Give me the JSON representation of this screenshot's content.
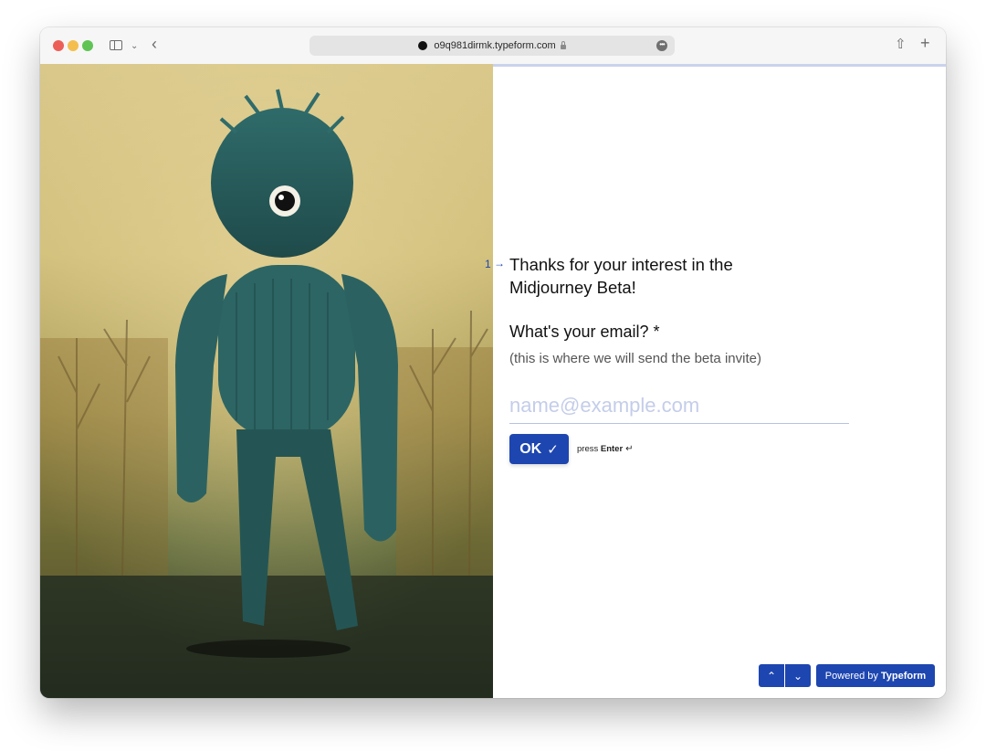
{
  "browser": {
    "url": "o9q981dirmk.typeform.com",
    "more_glyph": "•••"
  },
  "form": {
    "progress": 0.0,
    "question_number": "1",
    "question_arrow": "→",
    "intro_title": "Thanks for your interest in the Midjourney Beta!",
    "email_question": "What's your email? *",
    "email_hint": "(this is where we will send the beta invite)",
    "email_placeholder": "name@example.com",
    "email_value": "",
    "ok_label": "OK",
    "press_label": "press",
    "enter_label": "Enter",
    "enter_glyph": "↵"
  },
  "footer": {
    "powered_by_prefix": "Powered by",
    "brand": "Typeform",
    "up_glyph": "⌃",
    "down_glyph": "⌄"
  },
  "icons": {
    "back": "‹",
    "chevron": "⌄",
    "share": "⇧",
    "new_tab": "+",
    "check": "✓"
  },
  "colors": {
    "accent": "#1e46b0",
    "placeholder": "#c4cde9"
  }
}
